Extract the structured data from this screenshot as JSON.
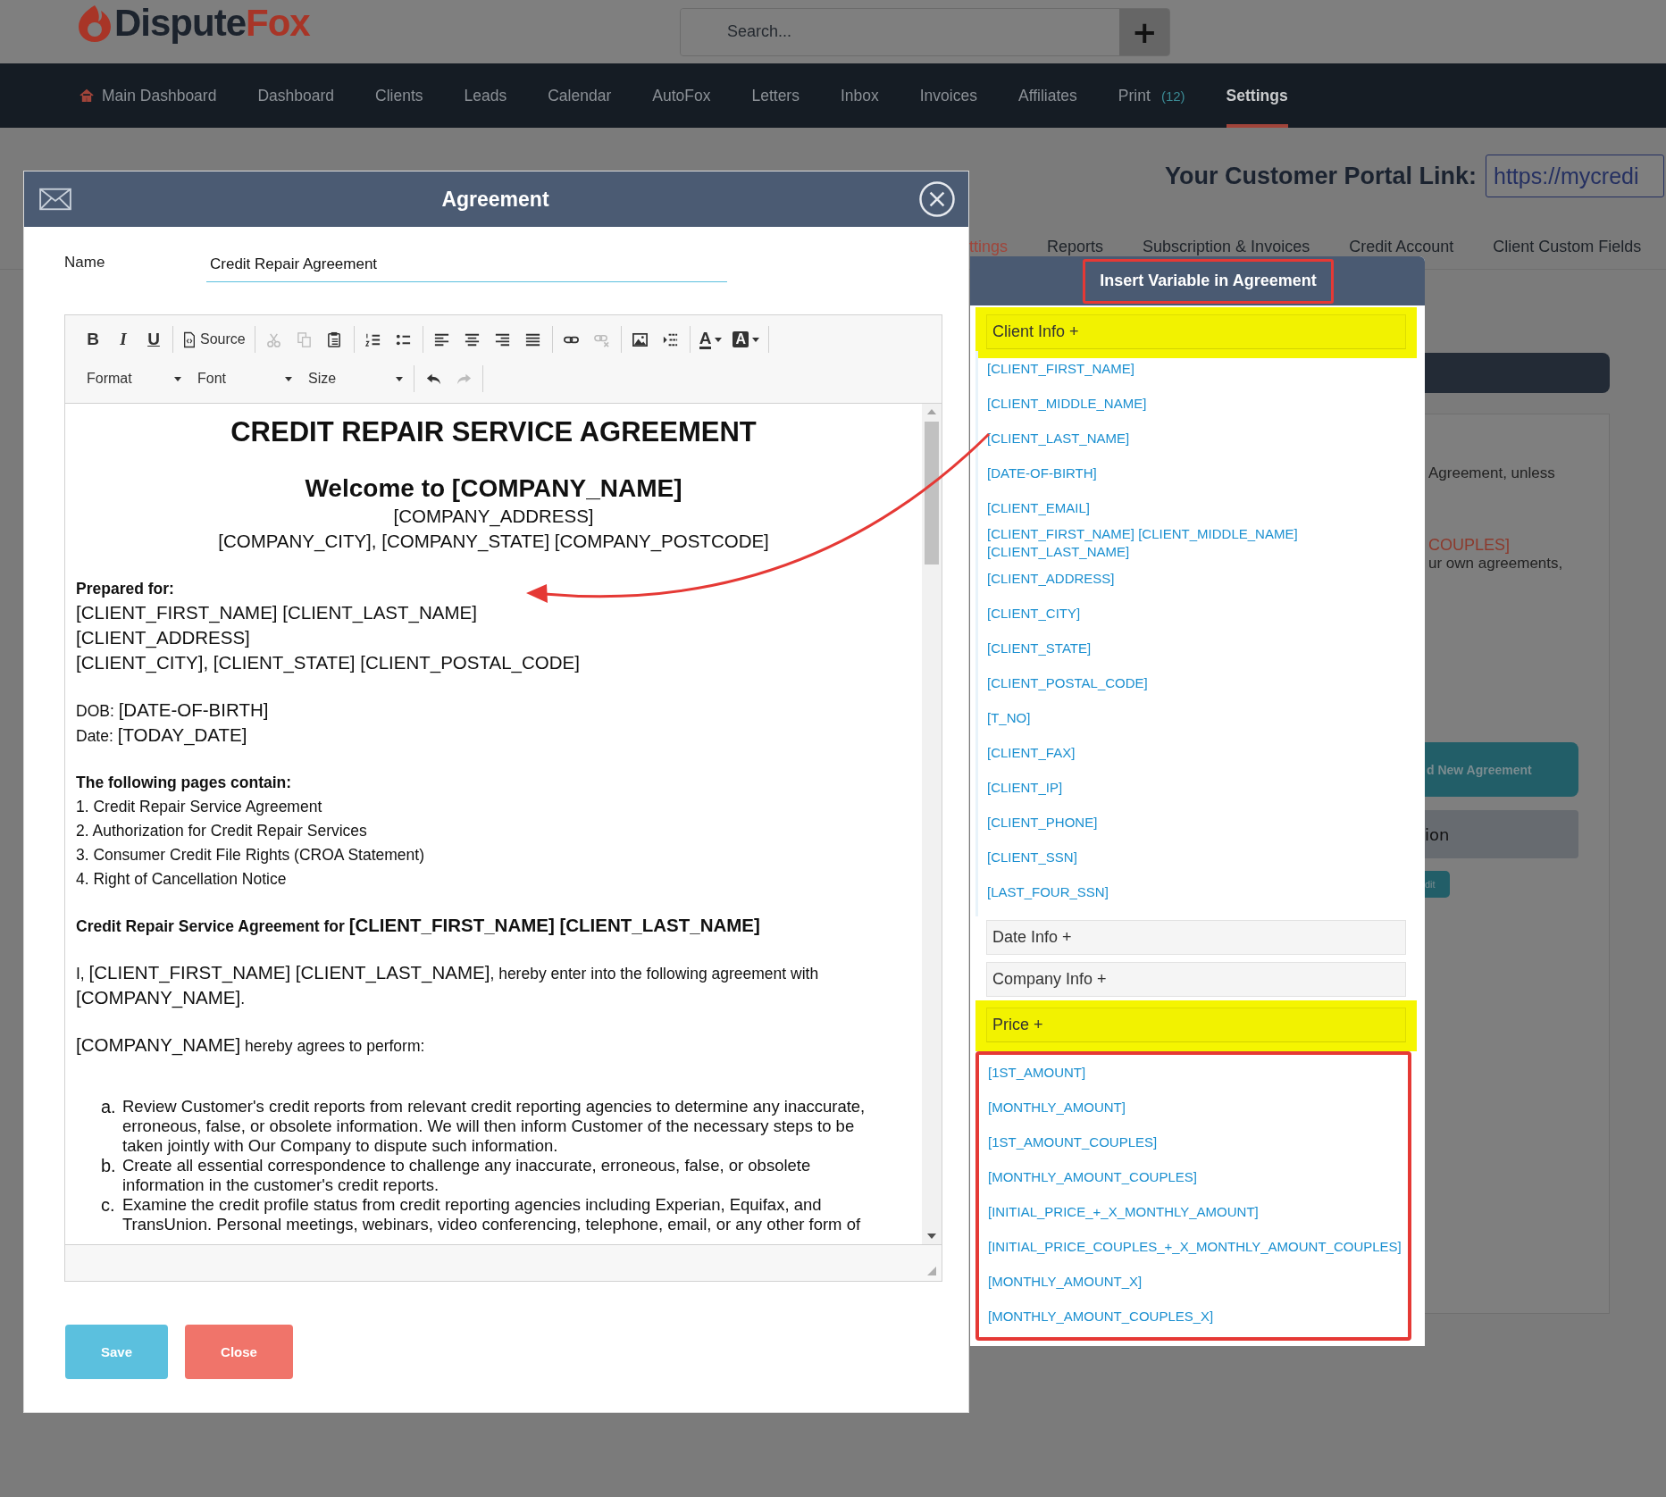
{
  "header": {
    "logo": {
      "name": "Dispute",
      "accent": "Fox"
    },
    "search": {
      "placeholder": "Search..."
    },
    "add_button": "+"
  },
  "nav": [
    {
      "label": "Main Dashboard",
      "kind": "home",
      "selected": false
    },
    {
      "label": "Dashboard",
      "kind": "plain",
      "selected": false
    },
    {
      "label": "Clients",
      "kind": "plain",
      "selected": false
    },
    {
      "label": "Leads",
      "kind": "plain",
      "selected": false
    },
    {
      "label": "Calendar",
      "kind": "plain",
      "selected": false
    },
    {
      "label": "AutoFox",
      "kind": "plain",
      "selected": false
    },
    {
      "label": "Letters",
      "kind": "plain",
      "selected": false
    },
    {
      "label": "Inbox",
      "kind": "plain",
      "selected": false
    },
    {
      "label": "Invoices",
      "kind": "plain",
      "selected": false
    },
    {
      "label": "Affiliates",
      "kind": "plain",
      "selected": false
    },
    {
      "label": "Print",
      "kind": "plain",
      "badge": "(12)",
      "selected": false
    },
    {
      "label": "Settings",
      "kind": "plain",
      "selected": true
    }
  ],
  "portal": {
    "label": "Your Customer Portal Link:",
    "value": "https://mycredi"
  },
  "settings_tabs": [
    {
      "label": "ttings",
      "selected": true
    },
    {
      "label": "Reports",
      "selected": false
    },
    {
      "label": "Subscription & Invoices",
      "selected": false
    },
    {
      "label": "Credit Account",
      "selected": false
    },
    {
      "label": "Client Custom Fields",
      "selected": false
    }
  ],
  "background_card": {
    "texts": [
      {
        "text": "Agreement, unless",
        "kind": "plain"
      },
      {
        "text": "COUPLES]",
        "kind": "variable"
      },
      {
        "text": "ur own agreements,",
        "kind": "plain"
      }
    ],
    "add_button": "d New Agreement",
    "section": "ion",
    "edit_button": "dit"
  },
  "modal": {
    "title": "Agreement",
    "name_field": {
      "label": "Name",
      "value": "Credit Repair Agreement"
    },
    "toolbar": {
      "groups": [
        [
          {
            "kind": "bold",
            "label": "B",
            "disabled": false
          },
          {
            "kind": "italic",
            "label": "I",
            "disabled": false
          },
          {
            "kind": "underline",
            "label": "U",
            "disabled": false
          }
        ],
        [
          {
            "kind": "source",
            "label": "Source",
            "disabled": false
          }
        ],
        [
          {
            "kind": "cut",
            "disabled": true
          },
          {
            "kind": "copy",
            "disabled": true
          },
          {
            "kind": "paste",
            "disabled": false
          }
        ],
        [
          {
            "kind": "numbered-list",
            "disabled": false
          },
          {
            "kind": "bulleted-list",
            "disabled": false
          }
        ],
        [
          {
            "kind": "align-left",
            "disabled": false
          },
          {
            "kind": "align-center",
            "disabled": false
          },
          {
            "kind": "align-right",
            "disabled": false
          },
          {
            "kind": "justify",
            "disabled": false
          }
        ],
        [
          {
            "kind": "link",
            "disabled": false
          },
          {
            "kind": "unlink",
            "disabled": true
          }
        ],
        [
          {
            "kind": "image",
            "disabled": false
          },
          {
            "kind": "blocks",
            "disabled": false
          }
        ],
        [
          {
            "kind": "text-color",
            "label": "A",
            "disabled": false
          },
          {
            "kind": "bg-color",
            "label": "A",
            "disabled": false
          }
        ]
      ],
      "dropdowns": [
        {
          "label": "Format"
        },
        {
          "label": "Font"
        },
        {
          "label": "Size"
        }
      ],
      "history": [
        {
          "kind": "undo",
          "disabled": false
        },
        {
          "kind": "redo",
          "disabled": true
        }
      ]
    },
    "content": [
      {
        "kind": "centered",
        "lines": [
          {
            "parts": [
              {
                "text": "CREDIT REPAIR SERVICE AGREEMENT",
                "kind": "title"
              }
            ]
          }
        ]
      },
      {
        "kind": "centered",
        "lines": [
          {
            "parts": [
              {
                "text": "Welcome to [COMPANY_NAME]",
                "kind": "heading"
              }
            ]
          },
          {
            "parts": [
              {
                "text": "[COMPANY_ADDRESS]",
                "kind": "large"
              }
            ]
          },
          {
            "parts": [
              {
                "text": "[COMPANY_CITY], [COMPANY_STATE] [COMPANY_POSTCODE]",
                "kind": "large"
              }
            ]
          }
        ]
      },
      {
        "kind": "text",
        "lines": [
          {
            "parts": [
              {
                "text": "Prepared for:",
                "kind": "strong"
              }
            ]
          },
          {
            "parts": [
              {
                "text": "[CLIENT_FIRST_NAME] [CLIENT_LAST_NAME]",
                "kind": "large"
              }
            ]
          },
          {
            "parts": [
              {
                "text": "[CLIENT_ADDRESS]",
                "kind": "large"
              }
            ]
          },
          {
            "parts": [
              {
                "text": "[CLIENT_CITY], [CLIENT_STATE] [CLIENT_POSTAL_CODE]",
                "kind": "large"
              }
            ]
          }
        ]
      },
      {
        "kind": "text",
        "lines": [
          {
            "parts": [
              {
                "text": "DOB: ",
                "kind": "small"
              },
              {
                "text": "[DATE-OF-BIRTH]",
                "kind": "large"
              }
            ]
          },
          {
            "parts": [
              {
                "text": "Date: ",
                "kind": "small"
              },
              {
                "text": "[TODAY_DATE]",
                "kind": "large"
              }
            ]
          }
        ]
      },
      {
        "kind": "text",
        "lines": [
          {
            "parts": [
              {
                "text": "The following pages contain:",
                "kind": "strong"
              }
            ]
          },
          {
            "parts": [
              {
                "text": "1. Credit Repair Service Agreement",
                "kind": "small"
              }
            ]
          },
          {
            "parts": [
              {
                "text": "2. Authorization for Credit Repair Services",
                "kind": "small"
              }
            ]
          },
          {
            "parts": [
              {
                "text": "3. Consumer Credit File Rights (CROA Statement)",
                "kind": "small"
              }
            ]
          },
          {
            "parts": [
              {
                "text": "4. Right of Cancellation Notice",
                "kind": "small"
              }
            ]
          }
        ]
      },
      {
        "kind": "text",
        "lines": [
          {
            "parts": [
              {
                "text": "Credit Repair Service Agreement for ",
                "kind": "strong"
              },
              {
                "text": "[CLIENT_FIRST_NAME] [CLIENT_LAST_NAME]",
                "kind": "emphasis"
              }
            ]
          }
        ]
      },
      {
        "kind": "text",
        "lines": [
          {
            "parts": [
              {
                "text": "I, ",
                "kind": "small"
              },
              {
                "text": "[CLIENT_FIRST_NAME] [CLIENT_LAST_NAME]",
                "kind": "large"
              },
              {
                "text": ", hereby enter into the following agreement with ",
                "kind": "small"
              },
              {
                "text": "[COMPANY_NAME]",
                "kind": "large"
              },
              {
                "text": ".",
                "kind": "small"
              }
            ]
          }
        ]
      },
      {
        "kind": "text",
        "lines": [
          {
            "parts": [
              {
                "text": "[COMPANY_NAME]",
                "kind": "large"
              },
              {
                "text": " hereby agrees to perform:",
                "kind": "small"
              }
            ]
          }
        ]
      },
      {
        "kind": "list",
        "items": [
          {
            "marker": "a.",
            "text": "Review Customer's credit reports from relevant credit reporting agencies to determine any inaccurate, erroneous, false, or obsolete information. We will then inform Customer of the necessary steps to be taken jointly with Our Company to dispute such information."
          },
          {
            "marker": "b.",
            "text": "Create all essential correspondence to challenge any inaccurate, erroneous, false, or obsolete information in the customer's credit reports."
          },
          {
            "marker": "c.",
            "text": "Examine the credit profile status from credit reporting agencies including Experian, Equifax, and TransUnion. Personal meetings, webinars, video conferencing, telephone, email, or any other form of"
          }
        ]
      }
    ],
    "buttons": [
      {
        "kind": "save",
        "label": "Save"
      },
      {
        "kind": "close",
        "label": "Close"
      }
    ]
  },
  "variables_panel": {
    "title": "Insert Variable in Agreement",
    "title_outlined": true,
    "groups": [
      {
        "label": "Client Info +",
        "highlighted": true,
        "expanded": true,
        "outlined": false,
        "items": [
          "[CLIENT_FIRST_NAME]",
          "[CLIENT_MIDDLE_NAME]",
          "[CLIENT_LAST_NAME]",
          "[DATE-OF-BIRTH]",
          "[CLIENT_EMAIL]",
          "[CLIENT_FIRST_NAME] [CLIENT_MIDDLE_NAME] [CLIENT_LAST_NAME]",
          "[CLIENT_ADDRESS]",
          "[CLIENT_CITY]",
          "[CLIENT_STATE]",
          "[CLIENT_POSTAL_CODE]",
          "[T_NO]",
          "[CLIENT_FAX]",
          "[CLIENT_IP]",
          "[CLIENT_PHONE]",
          "[CLIENT_SSN]",
          "[LAST_FOUR_SSN]"
        ]
      },
      {
        "label": "Date Info +",
        "highlighted": false,
        "expanded": false
      },
      {
        "label": "Company Info +",
        "highlighted": false,
        "expanded": false
      },
      {
        "label": "Price +",
        "highlighted": true,
        "expanded": true,
        "outlined": true,
        "items": [
          "[1ST_AMOUNT]",
          "[MONTHLY_AMOUNT]",
          "[1ST_AMOUNT_COUPLES]",
          "[MONTHLY_AMOUNT_COUPLES]",
          "[INITIAL_PRICE_+_X_MONTHLY_AMOUNT]",
          "[INITIAL_PRICE_COUPLES_+_X_MONTHLY_AMOUNT_COUPLES]",
          "[MONTHLY_AMOUNT_X]",
          "[MONTHLY_AMOUNT_COUPLES_X]"
        ]
      }
    ]
  }
}
